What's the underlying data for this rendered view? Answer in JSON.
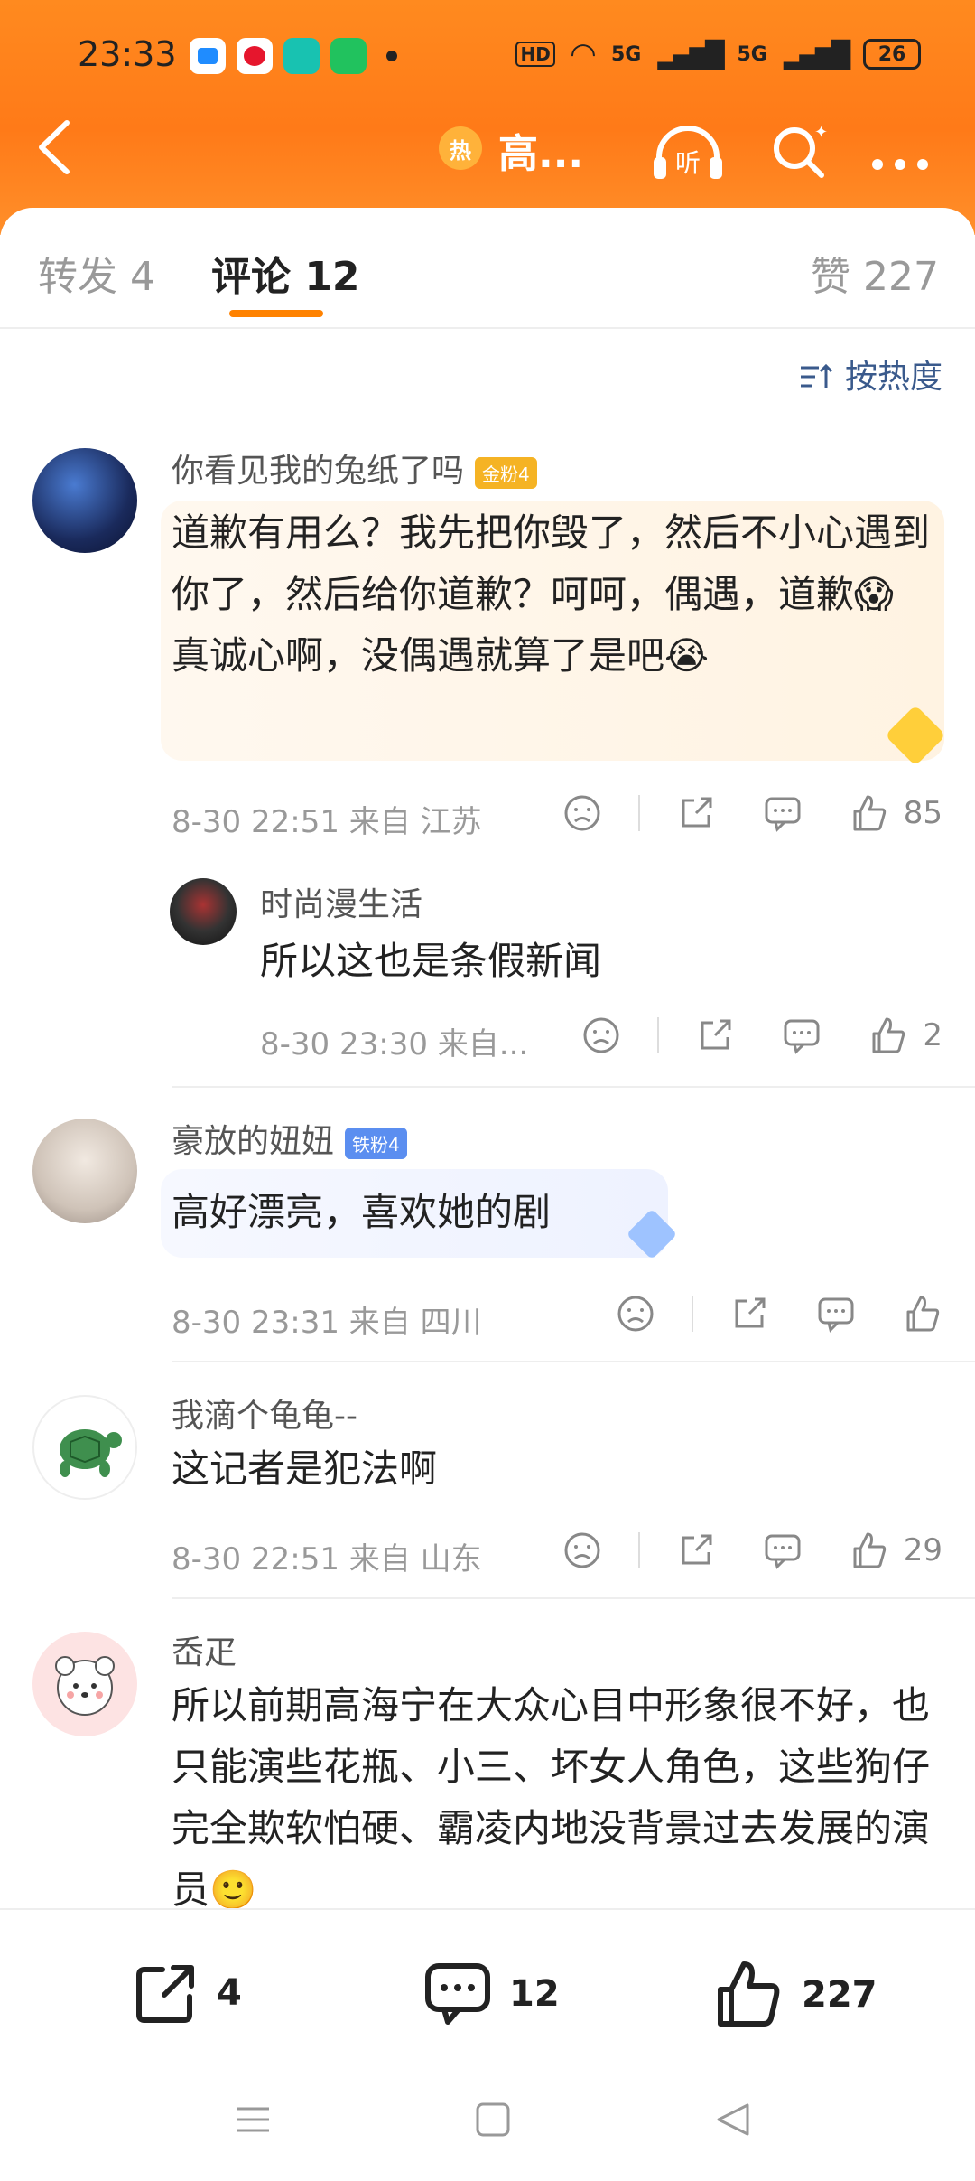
{
  "status": {
    "time": "23:33",
    "network": "5G",
    "battery": "26"
  },
  "nav": {
    "badge": "热",
    "title": "高...",
    "listen_label": "听"
  },
  "tabs": [
    {
      "label": "转发 4"
    },
    {
      "label": "评论 12"
    },
    {
      "label": "赞 227"
    }
  ],
  "sort_label": "按热度",
  "comments": [
    {
      "user": "你看见我的兔纸了吗",
      "badge": "金粉4",
      "text": "道歉有用么？我先把你毁了，然后不小心遇到你了，然后给你道歉？呵呵，偶遇，道歉😱真诚心啊，没偶遇就算了是吧😭",
      "meta": "8-30 22:51  来自 江苏",
      "likes": "85",
      "reply": {
        "user": "时尚漫生活",
        "text": "所以这也是条假新闻",
        "meta": "8-30 23:30  来自...",
        "likes": "2"
      }
    },
    {
      "user": "豪放的妞妞",
      "badge": "铁粉4",
      "text": "高好漂亮，喜欢她的剧",
      "meta": "8-30 23:31  来自 四川",
      "likes": ""
    },
    {
      "user": "我滴个龟龟--",
      "text": "这记者是犯法啊",
      "meta": "8-30 22:51  来自 山东",
      "likes": "29"
    },
    {
      "user": "岙疋",
      "text": "所以前期高海宁在大众心目中形象很不好，也只能演些花瓶、小三、坏女人角色，这些狗仔完全欺软怕硬、霸凌内地没背景过去发展的演员🙂"
    }
  ],
  "bottom": {
    "repost": "4",
    "comment": "12",
    "like": "227"
  },
  "icons": {
    "back": "chevron-left-icon",
    "listen": "headphones-icon",
    "search": "search-icon",
    "more": "more-icon",
    "sort": "sort-icon",
    "dislike": "frown-icon",
    "repost": "share-icon",
    "comment": "comment-icon",
    "like": "thumbs-up-icon"
  },
  "colors": {
    "accent": "#ff8200",
    "header": "#ff7a18",
    "sort": "#3a5a8c"
  }
}
